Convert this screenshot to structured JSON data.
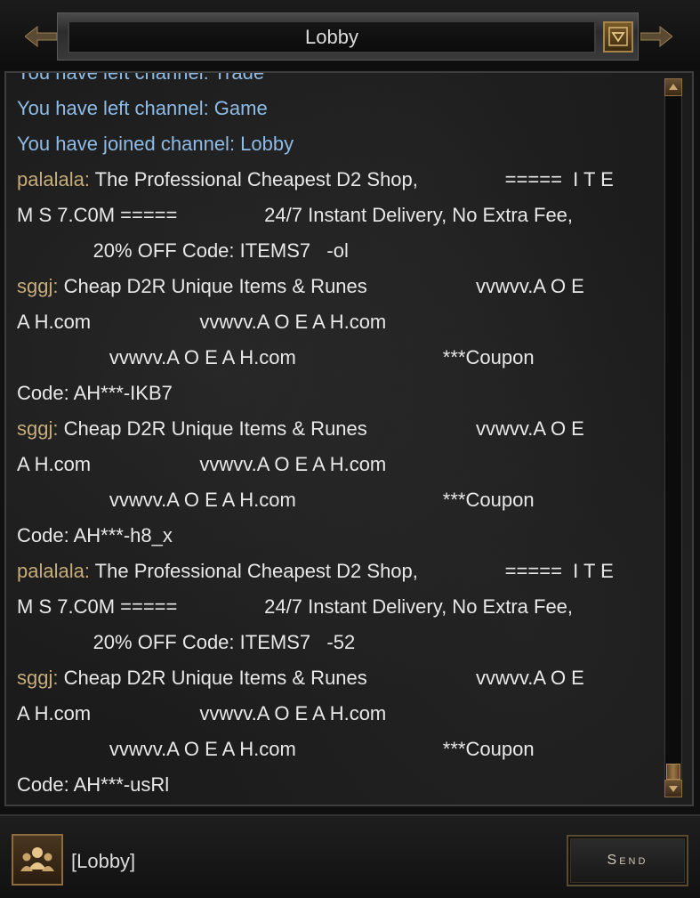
{
  "header": {
    "title": "Lobby"
  },
  "messages": [
    {
      "lines": [
        [
          {
            "t": "You have left channel: Trade",
            "c": "sys"
          }
        ]
      ]
    },
    {
      "lines": [
        [
          {
            "t": "You have left channel: Game",
            "c": "sys"
          }
        ]
      ]
    },
    {
      "lines": [
        [
          {
            "t": "You have joined channel: Lobby",
            "c": "sys"
          }
        ]
      ]
    },
    {
      "lines": [
        [
          {
            "t": "palalala:",
            "c": "nick"
          },
          {
            "t": " The Professional Cheapest D2 Shop,                =====  I T E"
          }
        ],
        [
          {
            "t": "M S 7.C0M =====                24/7 Instant Delivery, No Extra Fee,"
          }
        ],
        [
          {
            "t": "              20% OFF Code: ITEMS7   -ol"
          }
        ]
      ]
    },
    {
      "lines": [
        [
          {
            "t": "sggj:",
            "c": "nick"
          },
          {
            "t": " Cheap D2R Unique Items & Runes                    vvwvv.A O E"
          }
        ],
        [
          {
            "t": "A H.com                    vvwvv.A O E A H.com"
          }
        ],
        [
          {
            "t": "                 vvwvv.A O E A H.com                           ***Coupon"
          }
        ],
        [
          {
            "t": "Code: AH***-IKB7"
          }
        ]
      ]
    },
    {
      "lines": [
        [
          {
            "t": "sggj:",
            "c": "nick"
          },
          {
            "t": " Cheap D2R Unique Items & Runes                    vvwvv.A O E"
          }
        ],
        [
          {
            "t": "A H.com                    vvwvv.A O E A H.com"
          }
        ],
        [
          {
            "t": "                 vvwvv.A O E A H.com                           ***Coupon"
          }
        ],
        [
          {
            "t": "Code: AH***-h8_x"
          }
        ]
      ]
    },
    {
      "lines": [
        [
          {
            "t": "palalala:",
            "c": "nick"
          },
          {
            "t": " The Professional Cheapest D2 Shop,                =====  I T E"
          }
        ],
        [
          {
            "t": "M S 7.C0M =====                24/7 Instant Delivery, No Extra Fee,"
          }
        ],
        [
          {
            "t": "              20% OFF Code: ITEMS7   -52"
          }
        ]
      ]
    },
    {
      "lines": [
        [
          {
            "t": "sggj:",
            "c": "nick"
          },
          {
            "t": " Cheap D2R Unique Items & Runes                    vvwvv.A O E"
          }
        ],
        [
          {
            "t": "A H.com                    vvwvv.A O E A H.com"
          }
        ],
        [
          {
            "t": "                 vvwvv.A O E A H.com                           ***Coupon"
          }
        ],
        [
          {
            "t": "Code: AH***-usRl"
          }
        ]
      ]
    }
  ],
  "footer": {
    "channel_tag": "[Lobby]",
    "send_label": "Send"
  },
  "colors": {
    "system_text": "#8fbce6",
    "nick_text": "#c6ad7b",
    "body_text": "#e8e8e8"
  },
  "icons": {
    "dropdown": "chevron-down-icon",
    "channel_button": "users-icon"
  }
}
